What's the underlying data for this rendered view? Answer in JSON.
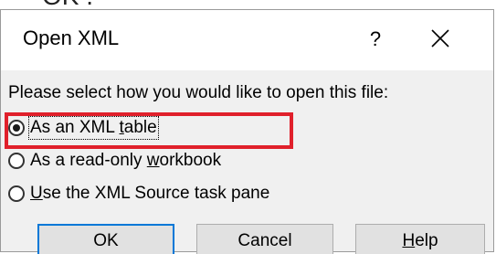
{
  "top_fragment": "OK .",
  "dialog": {
    "title": "Open XML",
    "help_glyph": "?",
    "prompt": "Please select how you would like to open this file:",
    "options": [
      {
        "pre": "As an XML ",
        "key": "t",
        "post": "able",
        "checked": true
      },
      {
        "pre": "As a read-only ",
        "key": "w",
        "post": "orkbook",
        "checked": false
      },
      {
        "pre": "",
        "key": "U",
        "post": "se the XML Source task pane",
        "checked": false
      }
    ],
    "buttons": {
      "ok": "OK",
      "cancel": "Cancel",
      "help_key": "H",
      "help_rest": "elp"
    }
  },
  "colors": {
    "highlight": "#e0202b",
    "dialog_bg": "#f0f0f0",
    "button_face": "#e1e1e1",
    "default_button_border": "#0078d7"
  },
  "icons": {
    "close": "close-icon",
    "help": "question-mark"
  }
}
